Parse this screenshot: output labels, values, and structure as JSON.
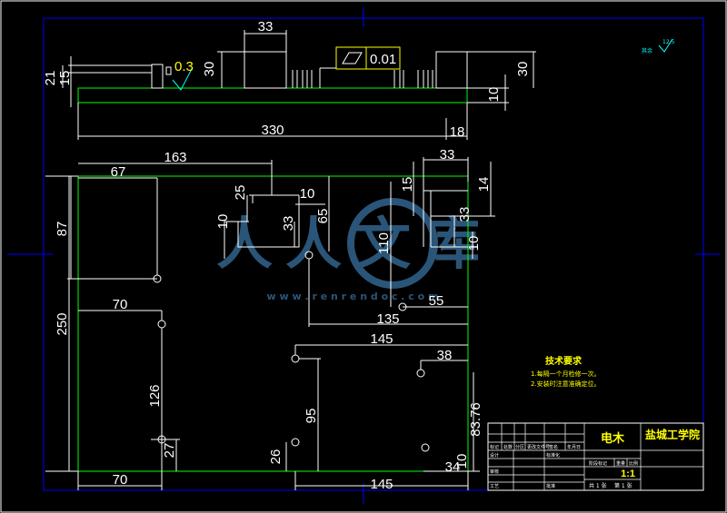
{
  "drawing": {
    "dimensions": {
      "top_width_33": "33",
      "left_height_21": "21",
      "left_height_15": "15",
      "height_30_left": "30",
      "height_30_right": "30",
      "thickness_10": "10",
      "overall_330": "330",
      "offset_18": "18",
      "width_163": "163",
      "width_67": "67",
      "height_87": "87",
      "height_250": "250",
      "width_70_top": "70",
      "height_126": "126",
      "height_27": "27",
      "width_70_bottom": "70",
      "slot_25": "25",
      "slot_10_h": "10",
      "slot_10_v": "10",
      "slot_33_v": "33",
      "height_65": "65",
      "height_110": "110",
      "width_33_right": "33",
      "height_15_right": "15",
      "height_14_right": "14",
      "height_33_right": "33",
      "height_10_right": "10",
      "width_55": "55",
      "width_135": "135",
      "width_145_mid": "145",
      "width_38": "38",
      "height_95": "95",
      "height_83_76": "83.76",
      "height_26": "26",
      "width_34": "34",
      "height_10_bottom": "10",
      "width_145_bottom": "145"
    },
    "flatness_tolerance": "0.01",
    "roughness_symbols": [
      {
        "value": "6.3",
        "label": "0.3"
      },
      {
        "value": "12.5",
        "label": "其余"
      }
    ],
    "watermark": {
      "brand_text": "人人文库",
      "url_text": "w w w . r e n r e n d o c . c o m"
    },
    "technical_requirements": {
      "title": "技术要求",
      "items": [
        "1.每隔一个月检修一次。",
        "2.安装时注意准确定位。"
      ]
    },
    "title_block": {
      "part_name": "电木",
      "school": "盐城工学院",
      "scale": "1:1",
      "labels": {
        "marker": "标记",
        "count": "处数",
        "zone": "分区",
        "change_doc": "更改文件号",
        "signature": "签名",
        "date": "年月日",
        "design": "设计",
        "standardization": "标准化",
        "stage_mark": "阶段标记",
        "weight": "重量",
        "ratio": "比例",
        "review": "审核",
        "process": "工艺",
        "approve": "批准",
        "sheets": "共 1 张",
        "sheet_no": "第 1 张"
      }
    },
    "colors": {
      "background": "#000000",
      "outline": "#00ff00",
      "dimension": "#ffffff",
      "frame": "#0000ff",
      "watermark": "#2f5f86",
      "note": "#ffff00"
    }
  }
}
